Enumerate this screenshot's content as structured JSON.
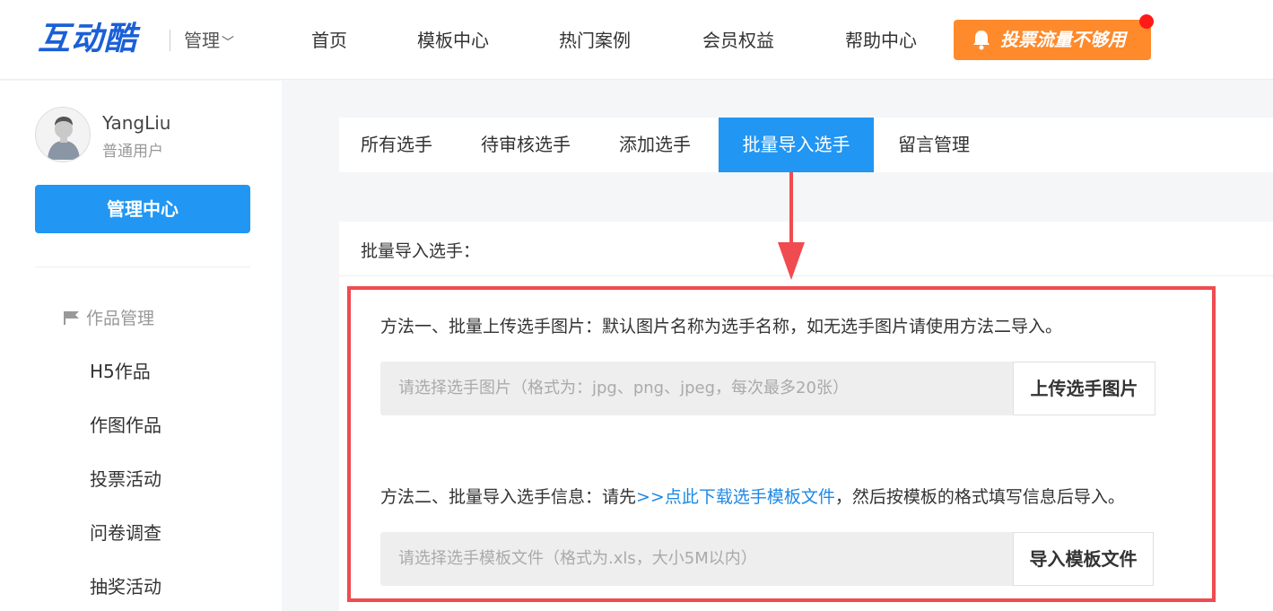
{
  "header": {
    "logo": "互动酷",
    "manage_label": "管理",
    "nav": [
      "首页",
      "模板中心",
      "热门案例",
      "会员权益",
      "帮助中心"
    ],
    "cta_label": "投票流量不够用"
  },
  "user": {
    "name": "YangLiu",
    "type": "普通用户"
  },
  "sidebar": {
    "admin_button": "管理中心",
    "section_title": "作品管理",
    "items": [
      "H5作品",
      "作图作品",
      "投票活动",
      "问卷调查",
      "抽奖活动"
    ]
  },
  "tabs": [
    {
      "label": "所有选手",
      "active": false
    },
    {
      "label": "待审核选手",
      "active": false
    },
    {
      "label": "添加选手",
      "active": false
    },
    {
      "label": "批量导入选手",
      "active": true
    },
    {
      "label": "留言管理",
      "active": false
    }
  ],
  "panel": {
    "title": "批量导入选手：",
    "method1": {
      "text": "方法一、批量上传选手图片：默认图片名称为选手名称，如无选手图片请使用方法二导入。",
      "placeholder": "请选择选手图片（格式为：jpg、png、jpeg，每次最多20张）",
      "button": "上传选手图片"
    },
    "method2": {
      "prefix": "方法二、批量导入选手信息：请先",
      "link": ">>点此下载选手模板文件",
      "suffix": "，然后按模板的格式填写信息后导入。",
      "placeholder": "请选择选手模板文件（格式为.xls，大小5M以内）",
      "button": "导入模板文件"
    }
  },
  "colors": {
    "accent_blue": "#2196f3",
    "cta_orange": "#ff8a2b",
    "annotation_red": "#ef4b50",
    "link_blue": "#1e88e5"
  }
}
